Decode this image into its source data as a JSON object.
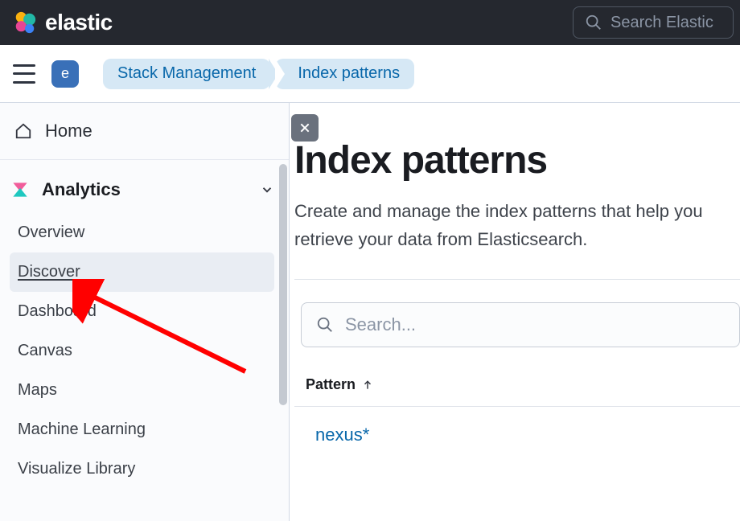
{
  "brand": {
    "name": "elastic"
  },
  "global_search": {
    "placeholder": "Search Elastic"
  },
  "space": {
    "letter": "e"
  },
  "breadcrumbs": [
    {
      "label": "Stack Management"
    },
    {
      "label": "Index patterns"
    }
  ],
  "sidebar": {
    "home_label": "Home",
    "section_title": "Analytics",
    "items": [
      {
        "label": "Overview",
        "active": false
      },
      {
        "label": "Discover",
        "active": true
      },
      {
        "label": "Dashboard",
        "active": false
      },
      {
        "label": "Canvas",
        "active": false
      },
      {
        "label": "Maps",
        "active": false
      },
      {
        "label": "Machine Learning",
        "active": false
      },
      {
        "label": "Visualize Library",
        "active": false
      }
    ]
  },
  "main": {
    "title": "Index patterns",
    "description": "Create and manage the index patterns that help you retrieve your data from Elasticsearch.",
    "search_placeholder": "Search...",
    "column_header": "Pattern",
    "rows": [
      {
        "name": "nexus*"
      }
    ]
  }
}
